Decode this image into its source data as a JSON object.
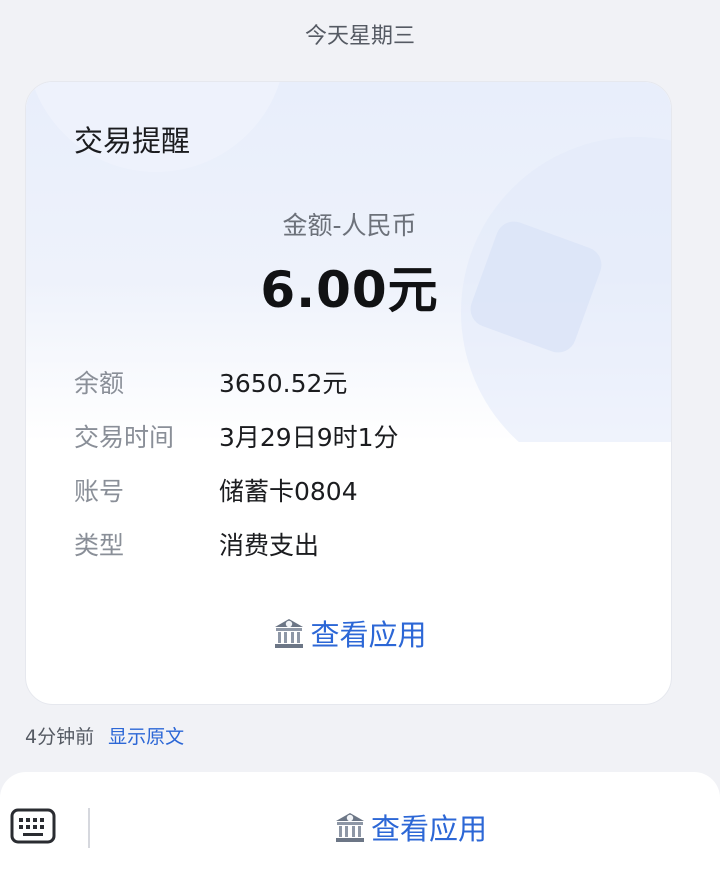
{
  "header": {
    "date_text": "今天星期三"
  },
  "card": {
    "title": "交易提醒",
    "amount_label": "金额-人民币",
    "amount_value": "6.00元",
    "rows": [
      {
        "key": "余额",
        "value": "3650.52元"
      },
      {
        "key": "交易时间",
        "value": "3月29日9时1分"
      },
      {
        "key": "账号",
        "value": "储蓄卡0804"
      },
      {
        "key": "类型",
        "value": "消费支出"
      }
    ],
    "action_label": "查看应用",
    "action_icon": "bank-icon"
  },
  "meta": {
    "time_ago": "4分钟前",
    "show_original": "显示原文"
  },
  "bottom_bar": {
    "keyboard_icon": "keyboard-icon",
    "action_label": "查看应用",
    "action_icon": "bank-icon"
  },
  "colors": {
    "accent": "#2c67d6",
    "background": "#f1f2f6",
    "card": "#ffffff"
  }
}
